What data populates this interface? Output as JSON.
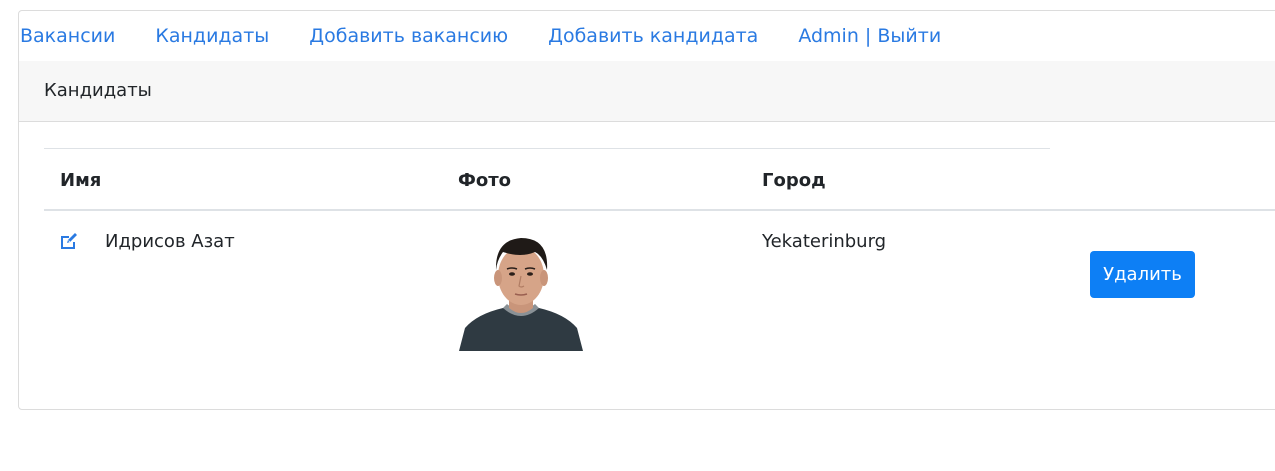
{
  "nav": {
    "items": [
      {
        "label": "Вакансии"
      },
      {
        "label": "Кандидаты"
      },
      {
        "label": "Добавить вакансию"
      },
      {
        "label": "Добавить кандидата"
      },
      {
        "label": "Admin | Выйти"
      }
    ],
    "link_color": "#2a7ae2"
  },
  "card": {
    "header_title": "Кандидаты"
  },
  "table": {
    "headers": {
      "name": "Имя",
      "photo": "Фото",
      "city": "Город"
    },
    "rows": [
      {
        "name": "Идрисов Азат",
        "city": "Yekaterinburg",
        "edit_icon": "pencil-square-icon",
        "delete_label": "Удалить"
      }
    ]
  },
  "colors": {
    "primary": "#0d7ff5",
    "header_bg": "#f7f7f7"
  }
}
